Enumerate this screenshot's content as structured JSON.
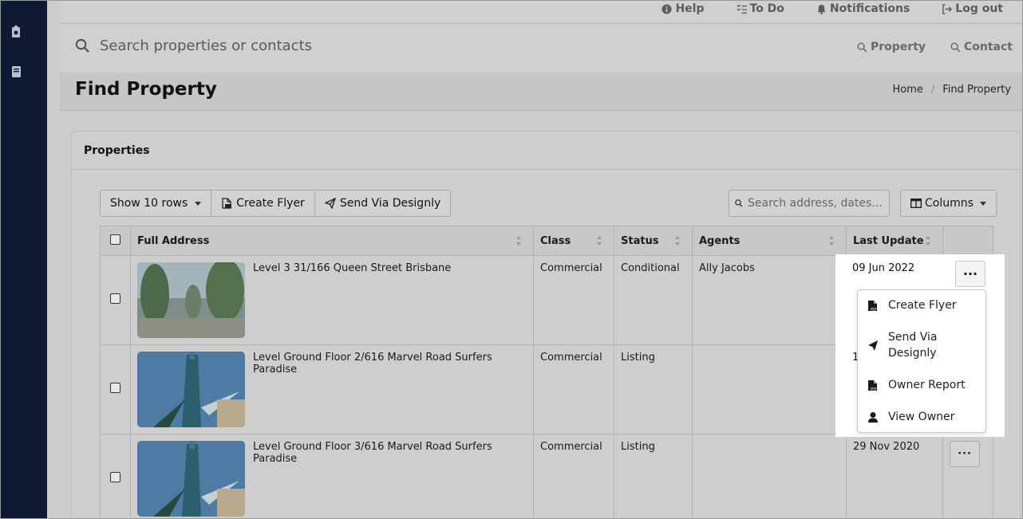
{
  "top_links": [
    {
      "label": "Help",
      "icon": "info-circle-icon"
    },
    {
      "label": "To Do",
      "icon": "checklist-icon"
    },
    {
      "label": "Notifications",
      "icon": "bell-icon"
    },
    {
      "label": "Log out",
      "icon": "logout-icon"
    }
  ],
  "search": {
    "placeholder": "Search properties or contacts"
  },
  "search_scopes": [
    {
      "label": "Property",
      "icon": "search-icon"
    },
    {
      "label": "Contact",
      "icon": "search-icon"
    }
  ],
  "page": {
    "title": "Find Property",
    "breadcrumb": [
      "Home",
      "Find Property"
    ]
  },
  "card": {
    "title": "Properties"
  },
  "toolbar": {
    "show_rows": "Show 10 rows",
    "create_flyer": "Create Flyer",
    "send_via": "Send Via Designly",
    "table_search_placeholder": "Search address, dates...",
    "columns": "Columns"
  },
  "table": {
    "headers": [
      "Full Address",
      "Class",
      "Status",
      "Agents",
      "Last Update"
    ],
    "rows": [
      {
        "address": "Level 3 31/166 Queen Street Brisbane",
        "class": "Commercial",
        "status": "Conditional",
        "agents": "Ally Jacobs",
        "last_update": "09 Jun 2022"
      },
      {
        "address": "Level Ground Floor 2/616 Marvel Road Surfers Paradise",
        "class": "Commercial",
        "status": "Listing",
        "agents": "",
        "last_update": "1"
      },
      {
        "address": "Level Ground Floor 3/616 Marvel Road Surfers Paradise",
        "class": "Commercial",
        "status": "Listing",
        "agents": "",
        "last_update": "29 Nov 2020"
      }
    ],
    "action_label": "···"
  },
  "row_menu": {
    "items": [
      {
        "label": "Create Flyer",
        "icon": "pdf-file-icon"
      },
      {
        "label": "Send Via Designly",
        "icon": "paper-plane-icon"
      },
      {
        "label": "Owner Report",
        "icon": "pdf-file-icon"
      },
      {
        "label": "View Owner",
        "icon": "user-icon"
      }
    ]
  },
  "colors": {
    "sidebar": "#0e1a33",
    "overlay": "#cdcdcd",
    "menu_bg": "#ffffff"
  }
}
